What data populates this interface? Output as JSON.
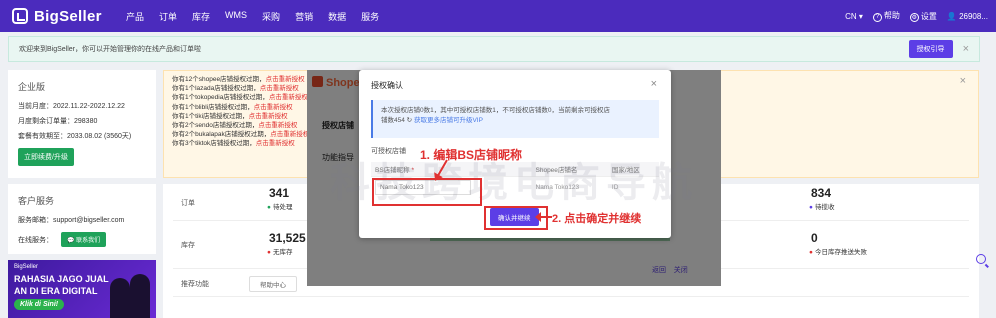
{
  "topbar": {
    "brand": "BigSeller",
    "nav": [
      "产品",
      "订单",
      "库存",
      "WMS",
      "采购",
      "营销",
      "数据",
      "服务"
    ],
    "lang": "CN ▾",
    "help": "帮助",
    "settings": "设置",
    "user": "26908..."
  },
  "welcome": {
    "text": "欢迎来到BigSeller，你可以开始管理你的在线产品和订单啦",
    "button": "授权引导",
    "close": "×"
  },
  "enterprise": {
    "title": "企业版",
    "rows": [
      "当前月度：2022.11.22-2022.12.22",
      "月度剩余订单量：298380",
      "套餐有效期至：2033.08.02 (3560天)"
    ],
    "upgrade": "立即续费/升级"
  },
  "service": {
    "title": "客户服务",
    "email": "服务邮箱：support@bigseller.com",
    "online": "在线服务：",
    "contact": "联系我们"
  },
  "banner": {
    "logo": "BigSeller",
    "line1": "RAHASIA JAGO JUAL",
    "line2": "AN DI ERA DIGITAL",
    "cta": "Klik di Sini!"
  },
  "authwarn": {
    "lines": [
      {
        "text": "你有12个shopee店铺授权过期，",
        "link": "点击重新授权"
      },
      {
        "text": "你有1个lazada店铺授权过期，",
        "link": "点击重新授权"
      },
      {
        "text": "你有1个tokopedia店铺授权过期，",
        "link": "点击重新授权"
      },
      {
        "text": "你有1个blibli店铺授权过期，",
        "link": "点击重新授权"
      },
      {
        "text": "你有1个tiki店铺授权过期，",
        "link": "点击重新授权"
      },
      {
        "text": "你有2个sendo店铺授权过期，",
        "link": "点击重新授权"
      },
      {
        "text": "你有2个bukalapak店铺授权过期，",
        "link": "点击重新授权"
      },
      {
        "text": "你有3个tiktok店铺授权过期，",
        "link": "点击重新授权"
      }
    ],
    "close": "×"
  },
  "stats": {
    "order_label": "订单",
    "order_num": "341",
    "order_sub": "待处理",
    "stock_label": "库存",
    "stock_num": "31,525",
    "stock_sub": "无库存",
    "right1_num": "834",
    "right1_sub": "待揽收",
    "right2_num": "0",
    "right2_sub": "今日库存推送失败",
    "recommend_label": "推荐功能",
    "help_chip": "帮助中心"
  },
  "under": {
    "shopee": "Shopee",
    "menu1": "授权店铺",
    "menu2": "功能指导",
    "back": "返回",
    "close": "关闭"
  },
  "modal": {
    "title": "授权确认",
    "close": "×",
    "info_line1": "本次授权店铺0数1，其中可授权店铺数1，不可授权店铺数0，当前剩余可授权店",
    "info_line2": "铺数454",
    "info_link": "获取更多店铺可升级VIP",
    "sub": "可授权店铺",
    "col1": "BS店铺昵称",
    "col2": "Shopee店铺名",
    "col3": "国家/地区",
    "row_nick": "Nama Toko123",
    "row_shop": "Nama Toko123",
    "row_region": "ID",
    "confirm": "确认并继续"
  },
  "annotations": {
    "step1": "1. 编辑BS店铺昵称",
    "step2": "2. 点击确定并继续"
  },
  "watermark": "科技跨境电商导航",
  "colors": {
    "topbar": "#4b2bbd",
    "primary": "#5c3ee6",
    "green": "#1fa25a",
    "red": "#e03131"
  }
}
